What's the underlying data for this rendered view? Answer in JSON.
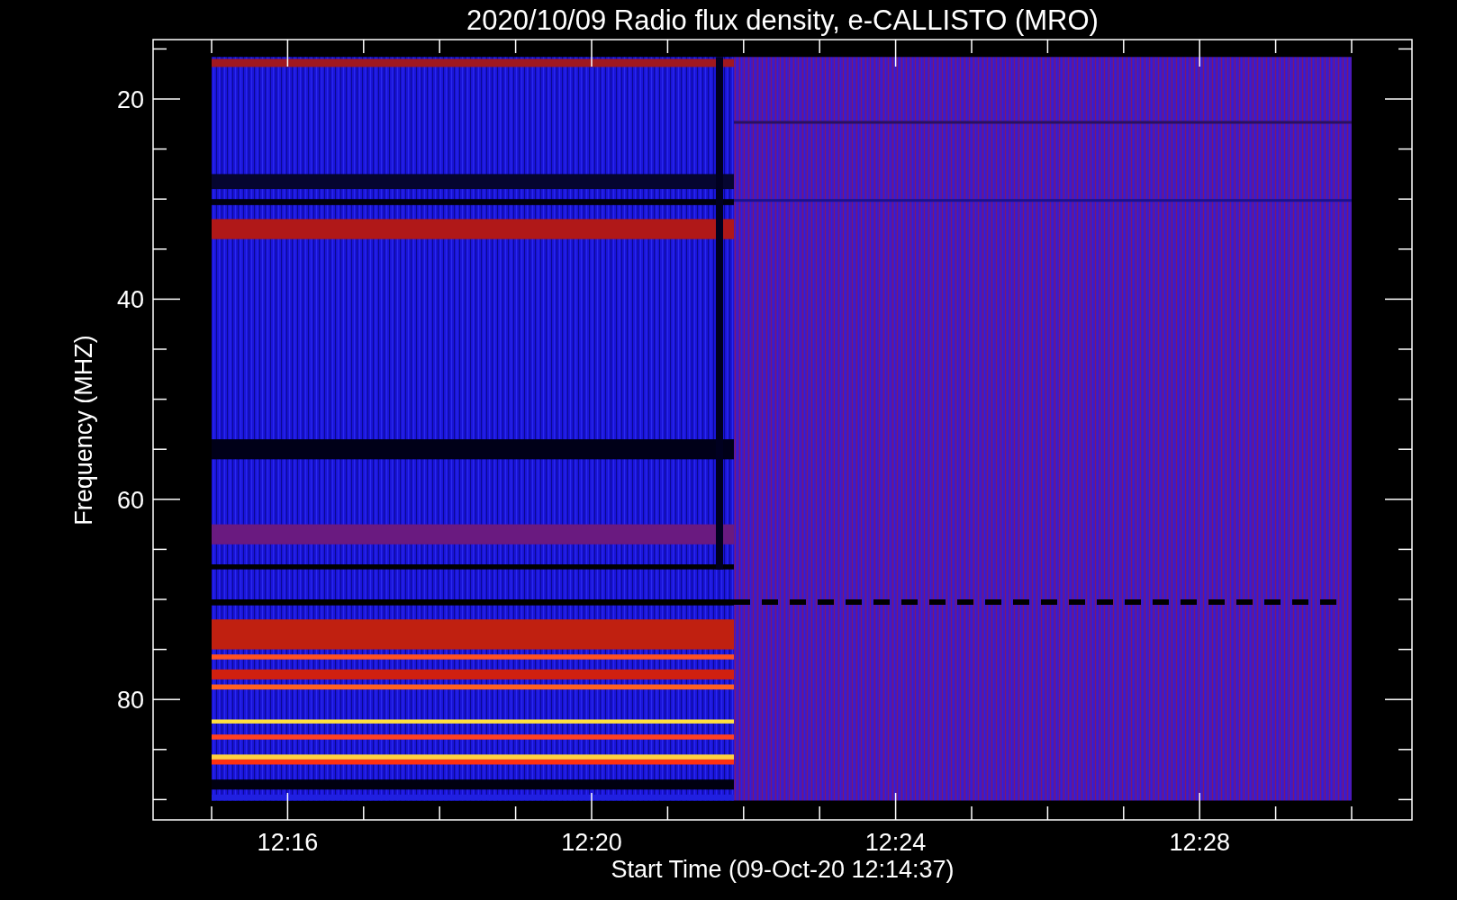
{
  "plot": {
    "title": "2020/10/09  Radio flux density, e-CALLISTO (MRO)",
    "ylabel": "Frequency (MHZ)",
    "xlabel": "Start Time (09-Oct-20 12:14:37)",
    "ytick_labels": [
      "20",
      "40",
      "60",
      "80"
    ],
    "xtick_labels": [
      "12:16",
      "12:20",
      "12:24",
      "12:28"
    ]
  }
}
